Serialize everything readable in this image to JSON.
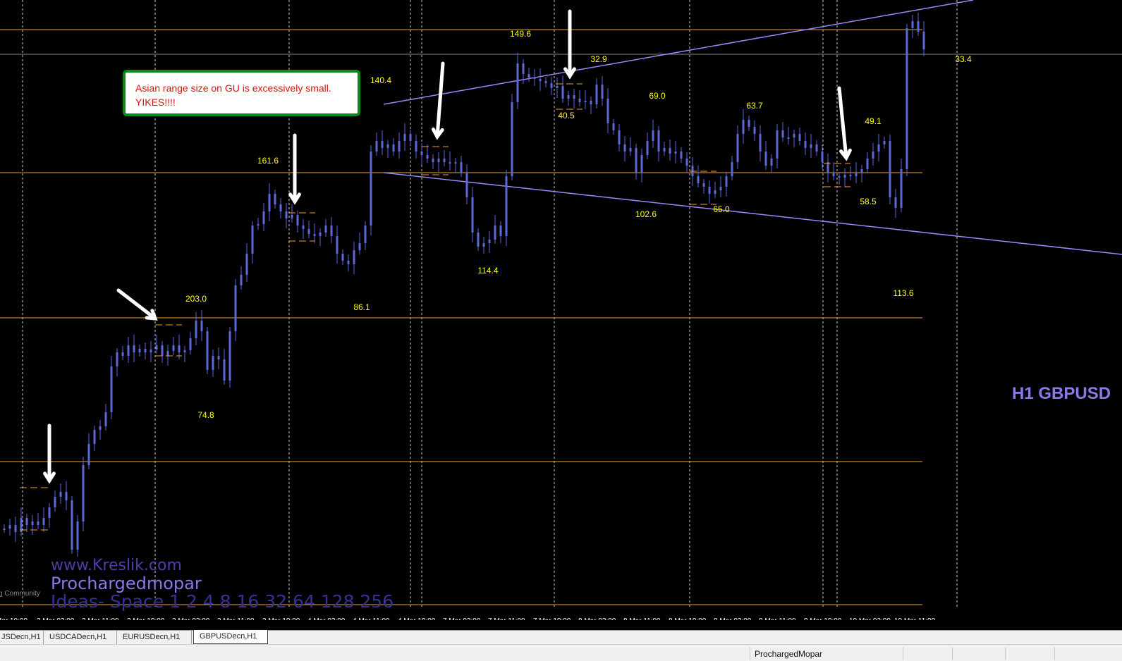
{
  "window": {
    "type": "trading-chart",
    "symbol_label": "H1 GBPUSD",
    "colors": {
      "background": "#000000",
      "candles": "#5b69d8",
      "range_lines": "#f0a030",
      "trendlines": "#9d86ff",
      "grid": "#ffffff",
      "range_labels": "#ffff00",
      "callout_text": "#e0100e",
      "callout_border": "#0c8a1c"
    }
  },
  "callout": {
    "line1": "Asian range size on GU is excessively small.",
    "line2": "YIKES!!!!"
  },
  "range_labels": [
    "203.0",
    "74.8",
    "161.6",
    "86.1",
    "140.4",
    "114.4",
    "149.6",
    "32.9",
    "40.5",
    "69.0",
    "102.6",
    "63.7",
    "65.0",
    "49.1",
    "58.5",
    "113.6",
    "33.4"
  ],
  "time_axis": [
    "Mar 19:00",
    "2 Mar 03:00",
    "2 Mar 11:00",
    "2 Mar 19:00",
    "3 Mar 03:00",
    "3 Mar 11:00",
    "3 Mar 19:00",
    "4 Mar 03:00",
    "4 Mar 11:00",
    "4 Mar 19:00",
    "7 Mar 03:00",
    "7 Mar 11:00",
    "7 Mar 19:00",
    "8 Mar 03:00",
    "8 Mar 11:00",
    "8 Mar 19:00",
    "9 Mar 03:00",
    "9 Mar 11:00",
    "9 Mar 19:00",
    "10 Mar 03:00",
    "10 Mar 11:00"
  ],
  "watermark": {
    "line1": "www.Kreslik.com",
    "line2": "Prochargedmopar",
    "line3": "Ideas- Space 1 2 4 8 16 32 64 128 256",
    "community": "g Community"
  },
  "tabs": [
    "JSDecn,H1",
    "USDCADecn,H1",
    "EURUSDecn,H1",
    "GBPUSDecn,H1"
  ],
  "active_tab": "GBPUSDecn,H1",
  "status_bar": {
    "profile": "ProchargedMopar"
  },
  "icons": [
    "arrow-annotation-icon"
  ]
}
